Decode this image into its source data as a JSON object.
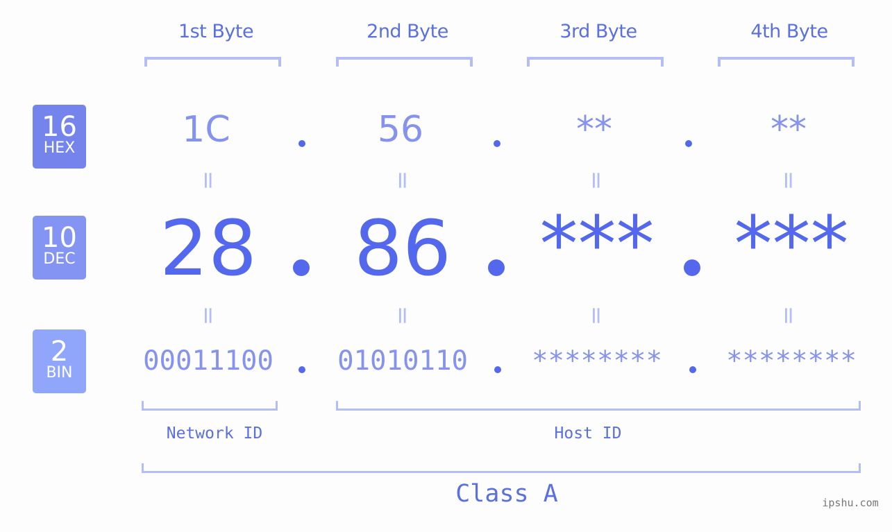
{
  "bytes": [
    {
      "label": "1st Byte",
      "hex": "1C",
      "dec": "28",
      "bin": "00011100"
    },
    {
      "label": "2nd Byte",
      "hex": "56",
      "dec": "86",
      "bin": "01010110"
    },
    {
      "label": "3rd Byte",
      "hex": "**",
      "dec": "***",
      "bin": "********"
    },
    {
      "label": "4th Byte",
      "hex": "**",
      "dec": "***",
      "bin": "********"
    }
  ],
  "bases": {
    "hex": {
      "num": "16",
      "name": "HEX",
      "color": "#7584ec"
    },
    "dec": {
      "num": "10",
      "name": "DEC",
      "color": "#8494f2"
    },
    "bin": {
      "num": "2",
      "name": "BIN",
      "color": "#8fa6fb"
    }
  },
  "equals_symbol": "=",
  "labels": {
    "network_id": "Network ID",
    "host_id": "Host ID",
    "class": "Class A"
  },
  "watermark": "ipshu.com",
  "colors": {
    "primary": "#5468ee",
    "light": "#8592ee",
    "bracket": "#b3bdf7"
  }
}
